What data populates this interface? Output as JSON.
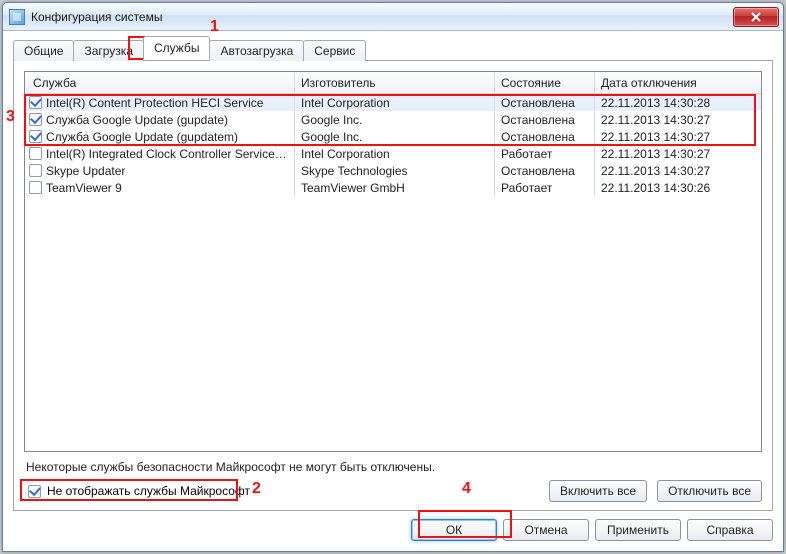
{
  "window": {
    "title": "Конфигурация системы"
  },
  "tabs": {
    "items": [
      {
        "label": "Общие"
      },
      {
        "label": "Загрузка"
      },
      {
        "label": "Службы"
      },
      {
        "label": "Автозагрузка"
      },
      {
        "label": "Сервис"
      }
    ],
    "active_index": 2
  },
  "columns": {
    "service": "Служба",
    "manufacturer": "Изготовитель",
    "state": "Состояние",
    "disabled_date": "Дата отключения"
  },
  "services": [
    {
      "checked": true,
      "name": "Intel(R) Content Protection HECI Service",
      "manufacturer": "Intel Corporation",
      "state": "Остановлена",
      "date": "22.11.2013 14:30:28"
    },
    {
      "checked": true,
      "name": "Служба Google Update (gupdate)",
      "manufacturer": "Google Inc.",
      "state": "Остановлена",
      "date": "22.11.2013 14:30:27"
    },
    {
      "checked": true,
      "name": "Служба Google Update (gupdatem)",
      "manufacturer": "Google Inc.",
      "state": "Остановлена",
      "date": "22.11.2013 14:30:27"
    },
    {
      "checked": false,
      "name": "Intel(R) Integrated Clock Controller Service - Int...",
      "manufacturer": "Intel Corporation",
      "state": "Работает",
      "date": "22.11.2013 14:30:27"
    },
    {
      "checked": false,
      "name": "Skype Updater",
      "manufacturer": "Skype Technologies",
      "state": "Остановлена",
      "date": "22.11.2013 14:30:27"
    },
    {
      "checked": false,
      "name": "TeamViewer 9",
      "manufacturer": "TeamViewer GmbH",
      "state": "Работает",
      "date": "22.11.2013 14:30:26"
    }
  ],
  "note": "Некоторые службы безопасности Майкрософт не могут быть отключены.",
  "hide_ms": {
    "checked": true,
    "label": "Не отображать службы Майкрософт"
  },
  "buttons": {
    "enable_all": "Включить все",
    "disable_all": "Отключить все",
    "ok": "ОК",
    "cancel": "Отмена",
    "apply": "Применить",
    "help": "Справка"
  },
  "annotations": {
    "n1": "1",
    "n2": "2",
    "n3": "3",
    "n4": "4"
  }
}
